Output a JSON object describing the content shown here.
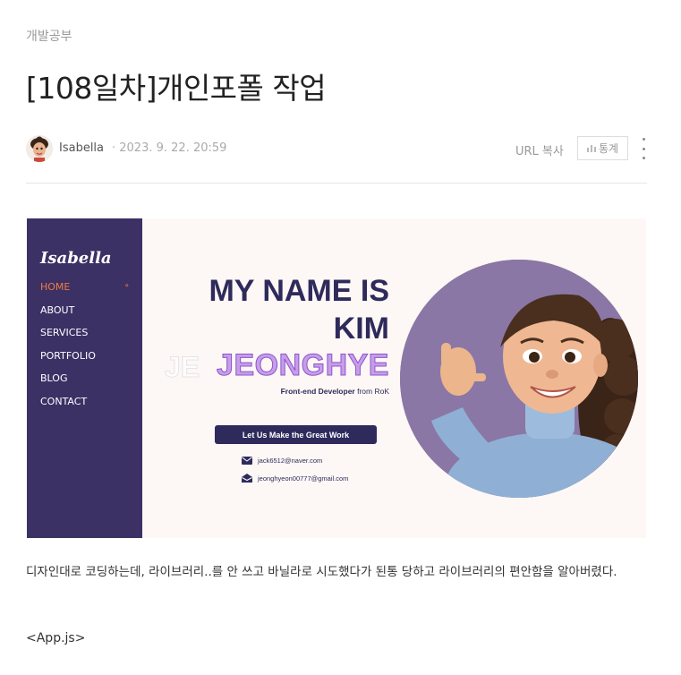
{
  "post": {
    "category": "개발공부",
    "title": "[108일차]개인포폴 작업",
    "author": "Isabella",
    "date": "· 2023. 9. 22. 20:59",
    "url_copy_label": "URL 복사",
    "stats_label": "통계",
    "more_icon": "more-vertical-icon"
  },
  "hero": {
    "logo": "Isabella",
    "menu": [
      "HOME",
      "ABOUT",
      "SERVICES",
      "PORTFOLIO",
      "BLOG",
      "CONTACT"
    ],
    "heading_line1": "MY NAME IS",
    "heading_line2": "KIM",
    "name": "JEONGHYE",
    "ghost_text": "JE",
    "subtitle_strong": "Front-end Developer",
    "subtitle_rest": " from RoK",
    "cta_label": "Let Us Make the Great Work",
    "email1": "jack6512@naver.com",
    "email2": "jeonghyeon00777@gmail.com",
    "accent_color": "#f07a3f",
    "sidebar_color": "#3b3165"
  },
  "body": {
    "paragraph": "디자인대로 코딩하는데, 라이브러리..를 안 쓰고 바닐라로 시도했다가 된통 당하고 라이브러리의 편안함을 알아버렸다.",
    "code_label": "<App.js>"
  }
}
